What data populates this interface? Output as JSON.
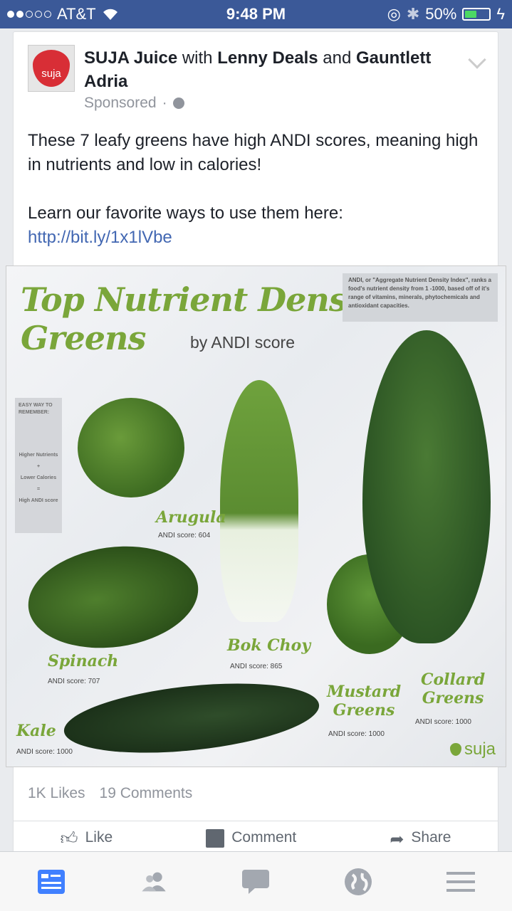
{
  "status_bar": {
    "carrier": "AT&T",
    "time": "9:48 PM",
    "battery": "50%",
    "battery_level": 0.5
  },
  "post": {
    "author": "SUJA Juice",
    "with_word": "with",
    "tagged1": "Lenny Deals",
    "and_word": "and",
    "tagged2": "Gauntlett Adria",
    "sponsored": "Sponsored",
    "separator": "·",
    "avatar_text": "suja",
    "text_line1": "These 7 leafy greens have high ANDI scores, meaning high in nutrients and low in calories!",
    "text_line2": "Learn our favorite ways to use them here:",
    "link": "http://bit.ly/1x1lVbe"
  },
  "infographic": {
    "title_line1": "Top Nutrient Dense",
    "title_line2": "Greens",
    "subtitle": "by ANDI score",
    "note": "ANDI, or \"Aggregate Nutrient Density Index\", ranks a food's nutrient density from 1 -1000, based off of it's range of vitamins, minerals, phytochemicals and antioxidant capacities.",
    "remember": {
      "title": "EASY WAY TO REMEMBER:",
      "higher": "Higher Nutrients",
      "plus": "+",
      "lower": "Lower Calories",
      "equals": "=",
      "high": "High ANDI score"
    },
    "veggies": {
      "arugula": {
        "name": "Arugula",
        "score": "ANDI score: 604"
      },
      "spinach": {
        "name": "Spinach",
        "score": "ANDI score: 707"
      },
      "bokchoy": {
        "name": "Bok Choy",
        "score": "ANDI score: 865"
      },
      "mustard": {
        "name_line1": "Mustard",
        "name_line2": "Greens",
        "score": "ANDI score: 1000"
      },
      "collard": {
        "name_line1": "Collard",
        "name_line2": "Greens",
        "score": "ANDI score: 1000"
      },
      "kale": {
        "name": "Kale",
        "score": "ANDI score: 1000"
      }
    },
    "logo": "suja"
  },
  "stats": {
    "likes": "1K Likes",
    "comments": "19 Comments"
  },
  "actions": {
    "like": "Like",
    "comment": "Comment",
    "share": "Share"
  },
  "bottom_nav": [
    "news-feed-icon",
    "friends-icon",
    "messages-icon",
    "globe-icon",
    "menu-icon"
  ],
  "colors": {
    "facebook_blue": "#3b5998",
    "link_blue": "#4267b2",
    "active_nav": "#4080ff",
    "green_title": "#7aa63a"
  }
}
